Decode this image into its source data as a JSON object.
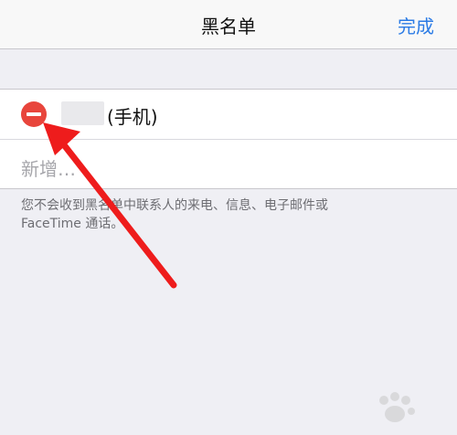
{
  "nav": {
    "title": "黑名单",
    "done_label": "完成"
  },
  "blocked_list": {
    "contact_suffix": "(手机)",
    "add_new_label": "新增…"
  },
  "footer": {
    "note_line1": "您不会收到黑名单中联系人的来电、信息、电子邮件或",
    "note_line2": "FaceTime 通话。"
  },
  "colors": {
    "accent": "#2b7be5",
    "delete": "#e8453c",
    "annotation_arrow": "#ee1c1c"
  },
  "icons": {
    "delete": "minus-circle-icon",
    "arrow": "annotation-arrow-icon",
    "watermark": "baidu-paw-logo"
  }
}
